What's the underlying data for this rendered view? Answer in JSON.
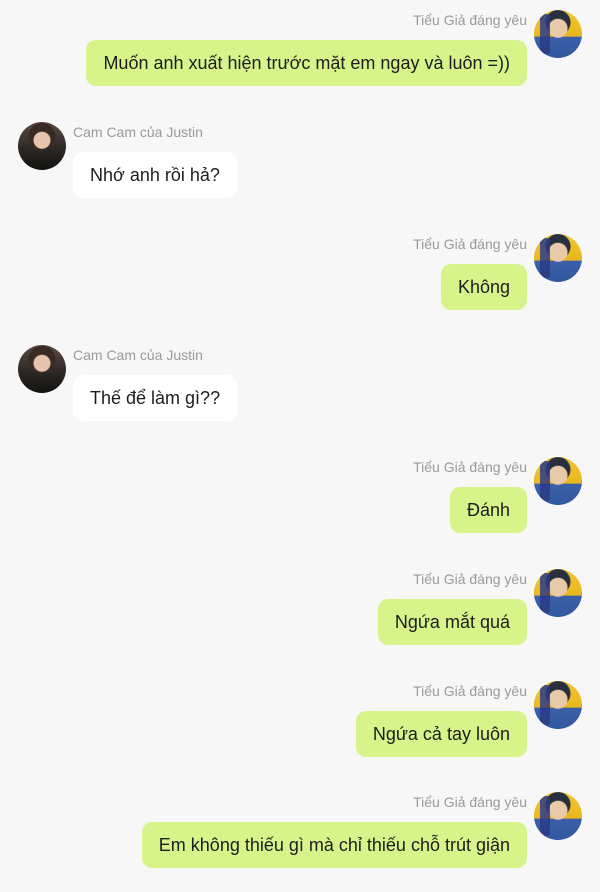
{
  "users": {
    "me": {
      "name": "Tiểu Giả đáng yêu",
      "bubble_color": "#d7f48a"
    },
    "other": {
      "name": "Cam Cam của Justin",
      "bubble_color": "#ffffff"
    }
  },
  "messages": [
    {
      "sender": "me",
      "name": "Tiểu Giả đáng yêu",
      "text": "Muốn anh xuất hiện trước mặt em ngay và luôn =))"
    },
    {
      "sender": "other",
      "name": "Cam Cam của Justin",
      "text": "Nhớ anh rồi hả?"
    },
    {
      "sender": "me",
      "name": "Tiểu Giả đáng yêu",
      "text": "Không"
    },
    {
      "sender": "other",
      "name": "Cam Cam của Justin",
      "text": "Thế để làm gì??"
    },
    {
      "sender": "me",
      "name": "Tiểu Giả đáng yêu",
      "text": "Đánh"
    },
    {
      "sender": "me",
      "name": "Tiểu Giả đáng yêu",
      "text": "Ngứa mắt quá"
    },
    {
      "sender": "me",
      "name": "Tiểu Giả đáng yêu",
      "text": "Ngứa cả tay luôn"
    },
    {
      "sender": "me",
      "name": "Tiểu Giả đáng yêu",
      "text": "Em không thiếu gì mà chỉ thiếu chỗ trút giận"
    }
  ]
}
